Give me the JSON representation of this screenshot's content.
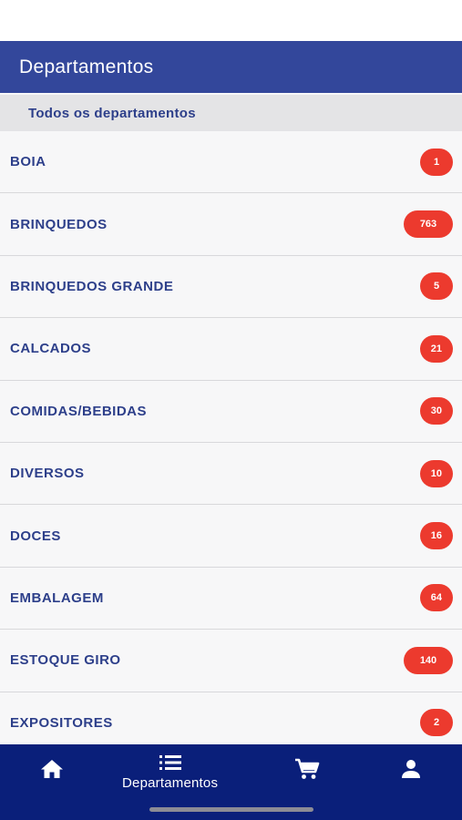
{
  "header": {
    "title": "Departamentos"
  },
  "section": {
    "title": "Todos os departamentos"
  },
  "departments": [
    {
      "label": "BOIA",
      "count": "1"
    },
    {
      "label": "BRINQUEDOS",
      "count": "763"
    },
    {
      "label": "BRINQUEDOS GRANDE",
      "count": "5"
    },
    {
      "label": "CALCADOS",
      "count": "21"
    },
    {
      "label": "COMIDAS/BEBIDAS",
      "count": "30"
    },
    {
      "label": "DIVERSOS",
      "count": "10"
    },
    {
      "label": "DOCES",
      "count": "16"
    },
    {
      "label": "EMBALAGEM",
      "count": "64"
    },
    {
      "label": "ESTOQUE GIRO",
      "count": "140"
    },
    {
      "label": "EXPOSITORES",
      "count": "2"
    }
  ],
  "tabbar": {
    "home_icon": "home-icon",
    "departments_icon": "list-icon",
    "departments_label": "Departamentos",
    "cart_icon": "cart-icon",
    "profile_icon": "person-icon"
  },
  "colors": {
    "header_bg": "#33479b",
    "tabbar_bg": "#0a1f7a",
    "badge": "#ec3a2e",
    "label": "#2d3f8a"
  }
}
